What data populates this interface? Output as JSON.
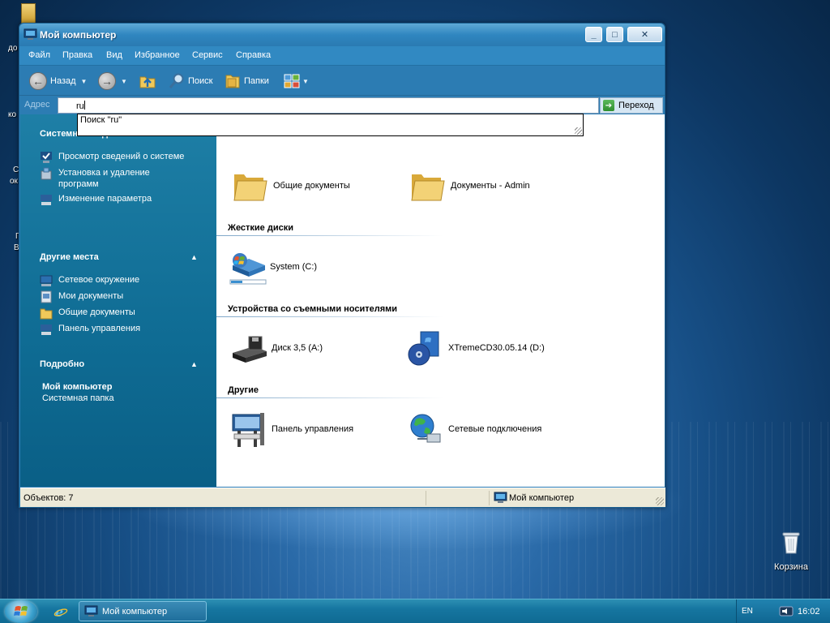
{
  "window": {
    "title": "Мой компьютер",
    "controls": {
      "minimize": "_",
      "maximize": "□",
      "close": "✕"
    }
  },
  "menu": [
    "Файл",
    "Правка",
    "Вид",
    "Избранное",
    "Сервис",
    "Справка"
  ],
  "toolbar": {
    "back_label": "Назад",
    "search_label": "Поиск",
    "folders_label": "Папки"
  },
  "address": {
    "label": "Адрес",
    "value": "ru",
    "go_label": "Переход",
    "suggestion": "Поиск \"ru\""
  },
  "tasks": {
    "system_header": "Системные задачи",
    "system_items": [
      "Просмотр сведений о системе",
      "Установка и удаление",
      "программ",
      "Изменение параметра"
    ],
    "places_header": "Другие места",
    "places_items": [
      "Сетевое окружение",
      "Мои документы",
      "Общие документы",
      "Панель управления"
    ],
    "details_header": "Подробно",
    "details_title": "Мой компьютер",
    "details_sub": "Системная папка"
  },
  "content": {
    "files": [
      "Общие документы",
      "Документы - Admin"
    ],
    "hdd_header": "Жесткие диски",
    "hdd": [
      "System (C:)"
    ],
    "removable_header": "Устройства со съемными носителями",
    "removable": [
      "Диск 3,5 (A:)",
      "XTremeCD30.05.14 (D:)"
    ],
    "other_header": "Другие",
    "other": [
      "Панель управления",
      "Сетевые подключения"
    ]
  },
  "status": {
    "objects": "Объектов: 7",
    "location": "Мой компьютер"
  },
  "desktop": {
    "recycle_bin": "Корзина",
    "fragments": [
      "до",
      "ко",
      "С",
      "ок",
      "Г",
      "В"
    ]
  },
  "taskbar": {
    "task": "Мой компьютер",
    "lang": "EN",
    "time": "16:02"
  },
  "colors": {
    "accent": "#2c7cb3",
    "left_pane": "#0f6c94",
    "taskbar": "#1676a0"
  },
  "icons": [
    "my-computer-icon",
    "folder-icon",
    "hdd-icon",
    "floppy-icon",
    "cd-icon",
    "control-panel-icon",
    "network-icon",
    "recycle-bin-icon",
    "start-orb-icon",
    "ie-icon",
    "xp-logo-icon"
  ]
}
